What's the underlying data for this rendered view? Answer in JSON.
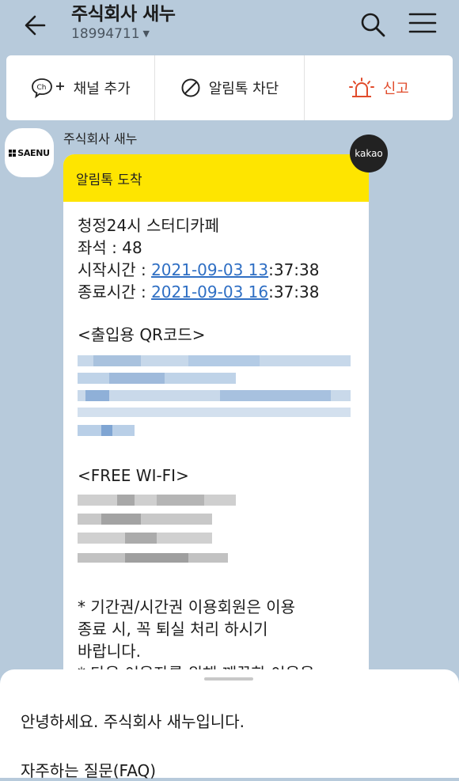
{
  "header": {
    "title": "주식회사 새누",
    "sub_id": "18994711",
    "caret": "▼"
  },
  "actions": {
    "add_channel": "채널 추가",
    "block_alimtalk": "알림톡 차단",
    "report": "신고"
  },
  "channel": {
    "avatar_text": "SAENU",
    "sender_name": "주식회사 새누",
    "badge": "kakao"
  },
  "message": {
    "header": "알림톡 도착",
    "store": "청정24시 스터디카페",
    "seat_label": "좌석 : 48",
    "start_label": "시작시간 : ",
    "start_date_link": "2021-09-03 13",
    "start_time_rest": ":37:38",
    "end_label": "종료시간 : ",
    "end_date_link": "2021-09-03 16",
    "end_time_rest": ":37:38",
    "qr_heading": "<출입용 QR코드>",
    "wifi_heading": "<FREE WI-FI>",
    "notice_1": "* 기간권/시간권 이용회원은 이용",
    "notice_2": "종료 시, 꼭 퇴실 처리 하시기",
    "notice_3": "바랍니다.",
    "notice_4": "* 다음 이용자를 위해 깨끗한 이용을"
  },
  "sheet": {
    "greeting": "안녕하세요. 주식회사 새누입니다.",
    "faq": "자주하는 질문(FAQ)"
  },
  "colors": {
    "background": "#b7cadb",
    "bubble_header": "#fee500",
    "link": "#2f6fc4",
    "report": "#e14b2b"
  }
}
